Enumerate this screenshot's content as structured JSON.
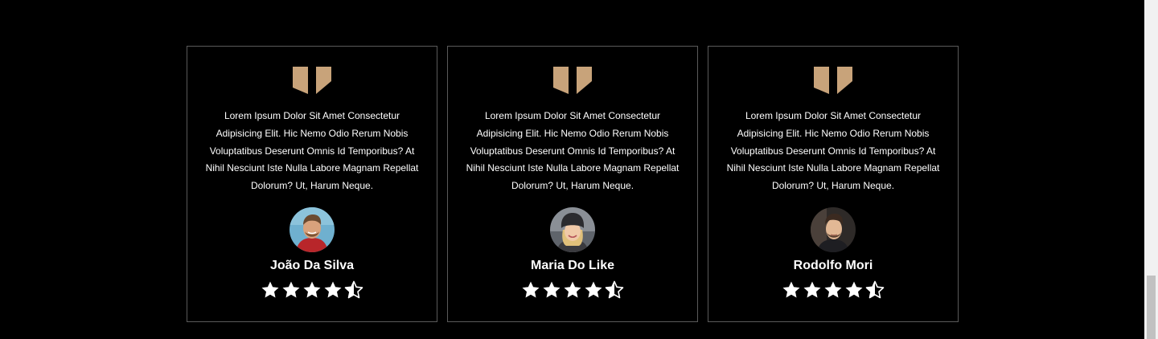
{
  "colors": {
    "background": "#000000",
    "accent": "#c8a37a",
    "text": "#ffffff",
    "card_border": "#5a5a5a"
  },
  "testimonials": [
    {
      "quote_icon": "quote-icon",
      "text": "Lorem Ipsum Dolor Sit Amet Consectetur Adipisicing Elit. Hic Nemo Odio Rerum Nobis Voluptatibus Deserunt Omnis Id Temporibus? At Nihil Nesciunt Iste Nulla Labore Magnam Repellat Dolorum? Ut, Harum Neque.",
      "avatar": "avatar-man-smiling",
      "name": "João Da Silva",
      "rating": 4.5,
      "max_rating": 5
    },
    {
      "quote_icon": "quote-icon",
      "text": "Lorem Ipsum Dolor Sit Amet Consectetur Adipisicing Elit. Hic Nemo Odio Rerum Nobis Voluptatibus Deserunt Omnis Id Temporibus? At Nihil Nesciunt Iste Nulla Labore Magnam Repellat Dolorum? Ut, Harum Neque.",
      "avatar": "avatar-woman-beanie",
      "name": "Maria Do Like",
      "rating": 4.5,
      "max_rating": 5
    },
    {
      "quote_icon": "quote-icon",
      "text": "Lorem Ipsum Dolor Sit Amet Consectetur Adipisicing Elit. Hic Nemo Odio Rerum Nobis Voluptatibus Deserunt Omnis Id Temporibus? At Nihil Nesciunt Iste Nulla Labore Magnam Repellat Dolorum? Ut, Harum Neque.",
      "avatar": "avatar-man-beard",
      "name": "Rodolfo Mori",
      "rating": 4.5,
      "max_rating": 5
    }
  ]
}
